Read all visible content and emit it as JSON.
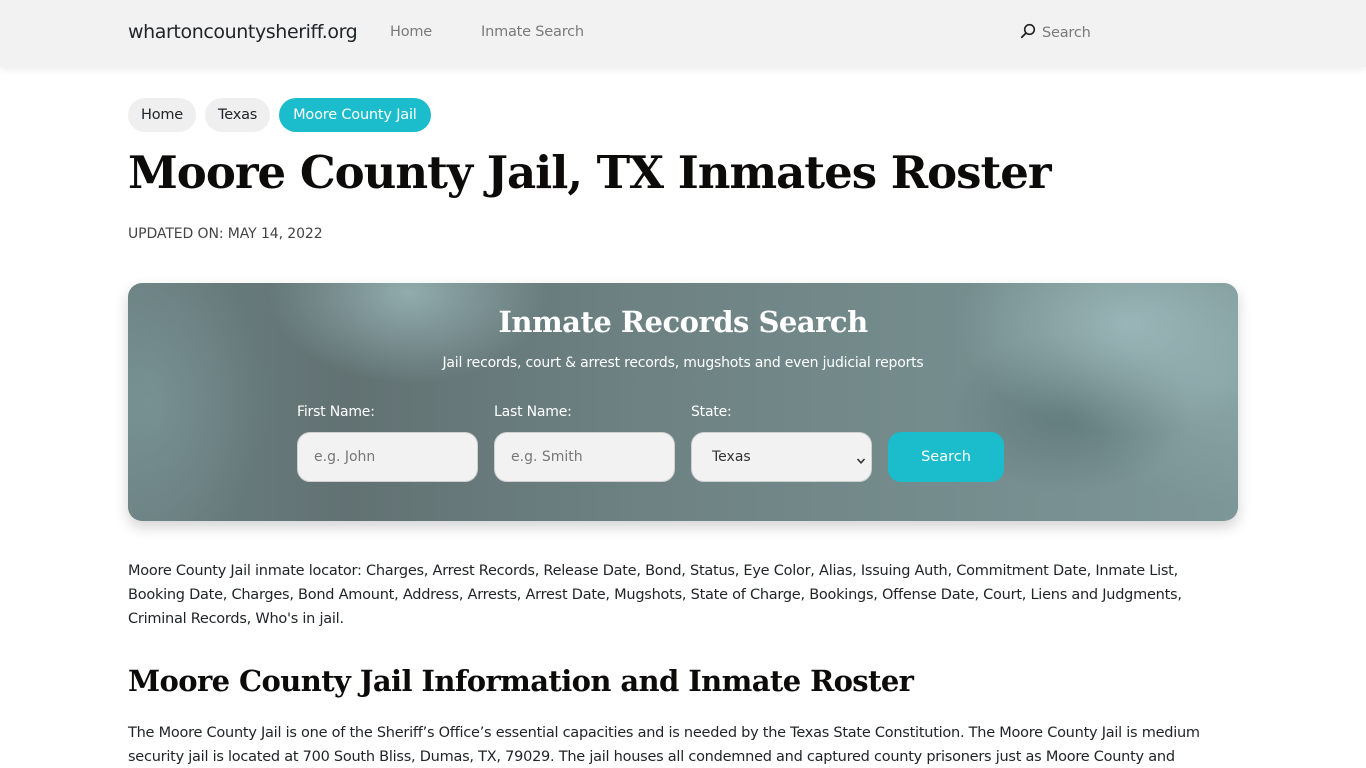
{
  "navbar": {
    "brand": "whartoncountysheriff.org",
    "links": [
      {
        "label": "Home"
      },
      {
        "label": "Inmate Search"
      }
    ],
    "search": {
      "icon": "search-icon",
      "label": "Search"
    }
  },
  "breadcrumb": [
    {
      "label": "Home",
      "active": false
    },
    {
      "label": "Texas",
      "active": false
    },
    {
      "label": "Moore County Jail",
      "active": true
    }
  ],
  "page": {
    "title": "Moore County Jail, TX Inmates Roster",
    "updated": "UPDATED ON: MAY 14, 2022"
  },
  "search_card": {
    "title": "Inmate Records Search",
    "subtitle": "Jail records, court & arrest records, mugshots and even judicial reports",
    "first_name": {
      "label": "First Name:",
      "placeholder": "e.g. John",
      "value": ""
    },
    "last_name": {
      "label": "Last Name:",
      "placeholder": "e.g. Smith",
      "value": ""
    },
    "state": {
      "label": "State:",
      "selected": "Texas"
    },
    "button_label": "Search"
  },
  "colors": {
    "accent": "#1bbccb",
    "navbar_bg": "#f2f2f2",
    "heading": "#0d0a0a"
  },
  "content": {
    "locator_text": "Moore County Jail inmate locator: Charges, Arrest Records, Release Date, Bond, Status, Eye Color, Alias, Issuing Auth, Commitment Date, Inmate List, Booking Date, Charges, Bond Amount, Address, Arrests, Arrest Date, Mugshots, State of Charge, Bookings, Offense Date, Court, Liens and Judgments, Criminal Records, Who's in jail.",
    "section_title": "Moore County Jail Information and Inmate Roster",
    "info_text": "The Moore County Jail is one of the Sheriff’s Office’s essential capacities and is needed by the Texas State Constitution. The Moore County Jail is medium security jail is located at 700 South Bliss, Dumas, TX, 79029. The jail houses all condemned and captured county prisoners just as Moore County and"
  }
}
